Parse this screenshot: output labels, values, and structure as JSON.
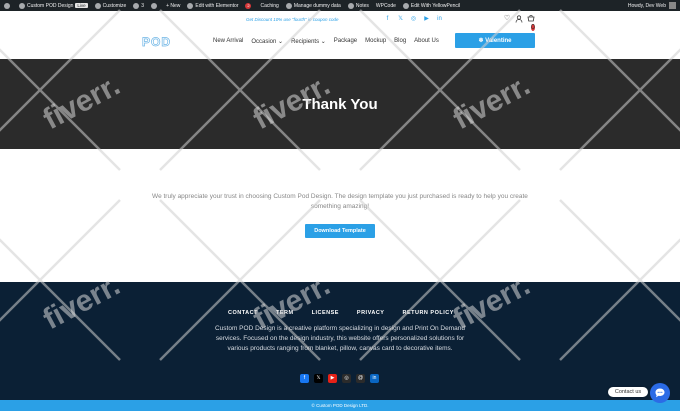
{
  "admin_bar": {
    "site_name": "Custom POD Design",
    "live_label": "Live",
    "customize": "Customize",
    "comments_count": "3",
    "new_label": "New",
    "edit_elementor": "Edit with Elementor",
    "notice_count": "2",
    "caching": "Caching",
    "dummy": "Manage dummy data",
    "notes": "Notes",
    "wpcode": "WPCode",
    "edit_yellow": "Edit With YellowPencil",
    "greeting": "Howdy, Dev Web"
  },
  "top_strip": {
    "promo": "Get Discount 10% use \"fourth\" in coupon code",
    "socials": [
      "facebook-icon",
      "x-icon",
      "instagram-icon",
      "youtube-icon",
      "linkedin-icon"
    ],
    "cart_count": "0"
  },
  "header": {
    "logo_text": "POD",
    "nav": [
      {
        "label": "New Arrival"
      },
      {
        "label": "Occasion",
        "dropdown": true
      },
      {
        "label": "Recipients",
        "dropdown": true
      },
      {
        "label": "Package"
      },
      {
        "label": "Mockup"
      },
      {
        "label": "Blog"
      },
      {
        "label": "About Us"
      }
    ],
    "cta_label": "❄ Valentine"
  },
  "hero": {
    "title": "Thank You"
  },
  "content": {
    "thanks_text": "We truly appreciate your trust in choosing Custom Pod Design. The design template you just purchased is ready to help you create something amazing!",
    "download_label": "Download Template"
  },
  "footer": {
    "links": [
      "CONTACT",
      "TERM",
      "LICENSE",
      "PRIVACY",
      "RETURN POLICY"
    ],
    "about": "Custom POD Design is a creative platform specializing in design and Print On Demand services. Focused on the design industry, this website offers personalized solutions for various products ranging from blanket, pillow, canvas card to decorative items.",
    "socials": [
      "facebook-icon",
      "x-icon",
      "youtube-icon",
      "instagram-icon",
      "threads-icon",
      "linkedin-icon"
    ],
    "copyright": "© Custom POD Design LTD."
  },
  "widgets": {
    "contact_label": "Contact us"
  },
  "colors": {
    "accent": "#2ba0e6",
    "hero_bg": "#2b2b2b",
    "footer_bg": "#0b2035",
    "admin_bg": "#1d2327"
  },
  "watermark": {
    "text": "fiverr."
  }
}
